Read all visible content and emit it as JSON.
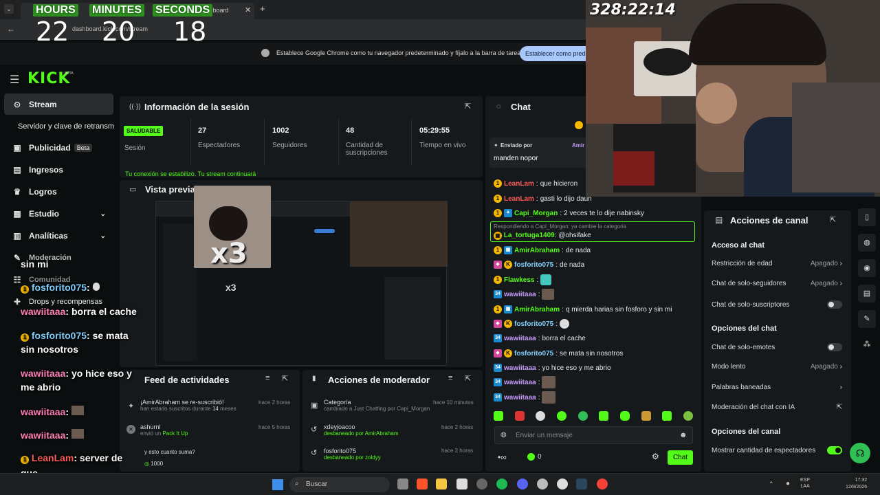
{
  "timer": {
    "hours_label": "HOURS",
    "minutes_label": "MINUTES",
    "seconds_label": "SECONDS",
    "hours": "22",
    "minutes": "20",
    "seconds": "18"
  },
  "stream_timer": "328:22:14",
  "browser": {
    "tab_title": "dashboard",
    "url": "dashboard.kick.com/stream",
    "prompt": "Establece Google Chrome como tu navegador predeterminado y fíjalo a la barra de tareas",
    "prompt_button": "Establecer como prede"
  },
  "brand": {
    "logo": "KICK",
    "beta": "BETA"
  },
  "sidebar": {
    "items": [
      {
        "label": "Stream",
        "icon": "broadcast-icon"
      },
      {
        "label": "Servidor y clave de retransm"
      },
      {
        "label": "Publicidad",
        "badge": "Beta",
        "icon": "megaphone-icon"
      },
      {
        "label": "Ingresos",
        "icon": "chart-icon"
      },
      {
        "label": "Logros",
        "icon": "trophy-icon"
      },
      {
        "label": "Estudio",
        "icon": "studio-icon"
      },
      {
        "label": "Analíticas",
        "icon": "analytics-icon"
      },
      {
        "label": "Moderación",
        "icon": "wrench-icon"
      },
      {
        "label": "Comunidad",
        "icon": "people-icon"
      },
      {
        "label": "Drops y recompensas",
        "icon": "gift-icon"
      }
    ]
  },
  "session": {
    "title": "Información de la sesión",
    "status": "SALUDABLE",
    "status_label": "Sesión",
    "stats": [
      {
        "value": "27",
        "label": "Espectadores"
      },
      {
        "value": "1002",
        "label": "Seguidores"
      },
      {
        "value": "48",
        "label": "Cantidad de suscripciones"
      },
      {
        "value": "05:29:55",
        "label": "Tiempo en vivo"
      }
    ],
    "notice": "Tu conexión se estabilizó. Tu stream continuará"
  },
  "preview": {
    "title": "Vista previa",
    "overlay_big": "x3",
    "overlay_small": "x3"
  },
  "feed": {
    "title": "Feed de actividades",
    "items": [
      {
        "text": "¡AmirAbraham se re-suscribió!",
        "sub_pre": "han estado suscritos durante ",
        "sub_num": "14",
        "sub_post": " meses",
        "time": "hace 2 horas"
      },
      {
        "text": "ashurnl",
        "sub_pre": "envió un ",
        "sub_num": "Pack It Up",
        "sub_post": "",
        "time": "hace 5 horas"
      },
      {
        "text": "y esto cuanto suma?",
        "sub_pre": "",
        "sub_num": "1000",
        "sub_post": "",
        "time": ""
      }
    ]
  },
  "mod": {
    "title": "Acciones de moderador",
    "items": [
      {
        "text": "Categoría",
        "sub": "cambiado a Just Chatting por Capi_Morgan",
        "time": "hace 10 minutos"
      },
      {
        "text": "xdeyjoacoo",
        "sub": "desbaneado por AmirAbraham",
        "time": "hace 2 horas"
      },
      {
        "text": "fosforito075",
        "sub": "desbaneado por zoldyy",
        "time": "hace 2 horas"
      }
    ]
  },
  "chat": {
    "title": "Chat",
    "pinned_prefix": "Enviado por",
    "pinned_user": "Amir",
    "pinned_msg": "manden nopor",
    "messages": [
      {
        "user": "LeanLam",
        "msg": "que hicieron",
        "color": "r"
      },
      {
        "user": "LeanLam",
        "msg": "gasti lo dijo daun",
        "color": "r"
      },
      {
        "user": "Capi_Morgan",
        "msg": "2 veces te lo dije nabinsky",
        "color": "g"
      },
      {
        "user": "La_tortuga1409",
        "msg": "@ohsifake",
        "color": "g",
        "reply": "Respondiendo a Capi_Morgan: ya cambie la categoria"
      },
      {
        "user": "AmirAbraham",
        "msg": "de nada",
        "color": "g"
      },
      {
        "user": "fosforito075",
        "msg": "de nada",
        "color": "b"
      },
      {
        "user": "Flawkess",
        "msg": "",
        "color": "g"
      },
      {
        "user": "wawiitaaa",
        "msg": "",
        "color": "v"
      },
      {
        "user": "AmirAbraham",
        "msg": "q mierda harias sin fosforo y sin mi",
        "color": "g"
      },
      {
        "user": "fosforito075",
        "msg": "",
        "color": "b"
      },
      {
        "user": "wawiitaaa",
        "msg": "borra el cache",
        "color": "v"
      },
      {
        "user": "fosforito075",
        "msg": "se mata sin nosotros",
        "color": "b"
      },
      {
        "user": "wawiitaaa",
        "msg": "yo hice eso y me abrio",
        "color": "v"
      },
      {
        "user": "wawiitaaa",
        "msg": "",
        "color": "v"
      },
      {
        "user": "wawiitaaa",
        "msg": "",
        "color": "v"
      }
    ],
    "input_placeholder": "Enviar un mensaje",
    "send": "Chat",
    "points": "0"
  },
  "overlay_chat": [
    {
      "text": "sin mi"
    },
    {
      "user": "fosforito075",
      "msg": ""
    },
    {
      "user": "wawiitaaa",
      "msg": "borra el cache"
    },
    {
      "user": "fosforito075",
      "msg": "se mata"
    },
    {
      "cont": "sin nosotros"
    },
    {
      "user": "wawiitaaa",
      "msg": "yo hice eso y"
    },
    {
      "cont": "me abrio"
    },
    {
      "user": "wawiitaaa",
      "msg": ""
    },
    {
      "user": "wawiitaaa",
      "msg": ""
    },
    {
      "user": "LeanLam",
      "msg": "server de"
    },
    {
      "cont": "que"
    }
  ],
  "channel": {
    "title": "Acciones de canal",
    "section_chat_access": "Acceso al chat",
    "age": "Restricción de edad",
    "age_val": "Apagado",
    "followers": "Chat de solo-seguidores",
    "followers_val": "Apagado",
    "subs": "Chat de solo-suscriptores",
    "section_chat_opts": "Opciones del chat",
    "emotes": "Chat de solo-emotes",
    "slow": "Modo lento",
    "slow_val": "Apagado",
    "banned": "Palabras baneadas",
    "ai": "Moderación del chat con IA",
    "section_channel_opts": "Opciones del canal",
    "viewers": "Mostrar cantidad de espectadores"
  },
  "taskbar": {
    "search": "Buscar",
    "lang": "ESP",
    "lang2": "LAA",
    "time": "17:32",
    "date": "12/8/2026"
  },
  "colors": {
    "kick_green": "#53fc18",
    "panel": "#16191b",
    "bg": "#0b0e0f"
  }
}
